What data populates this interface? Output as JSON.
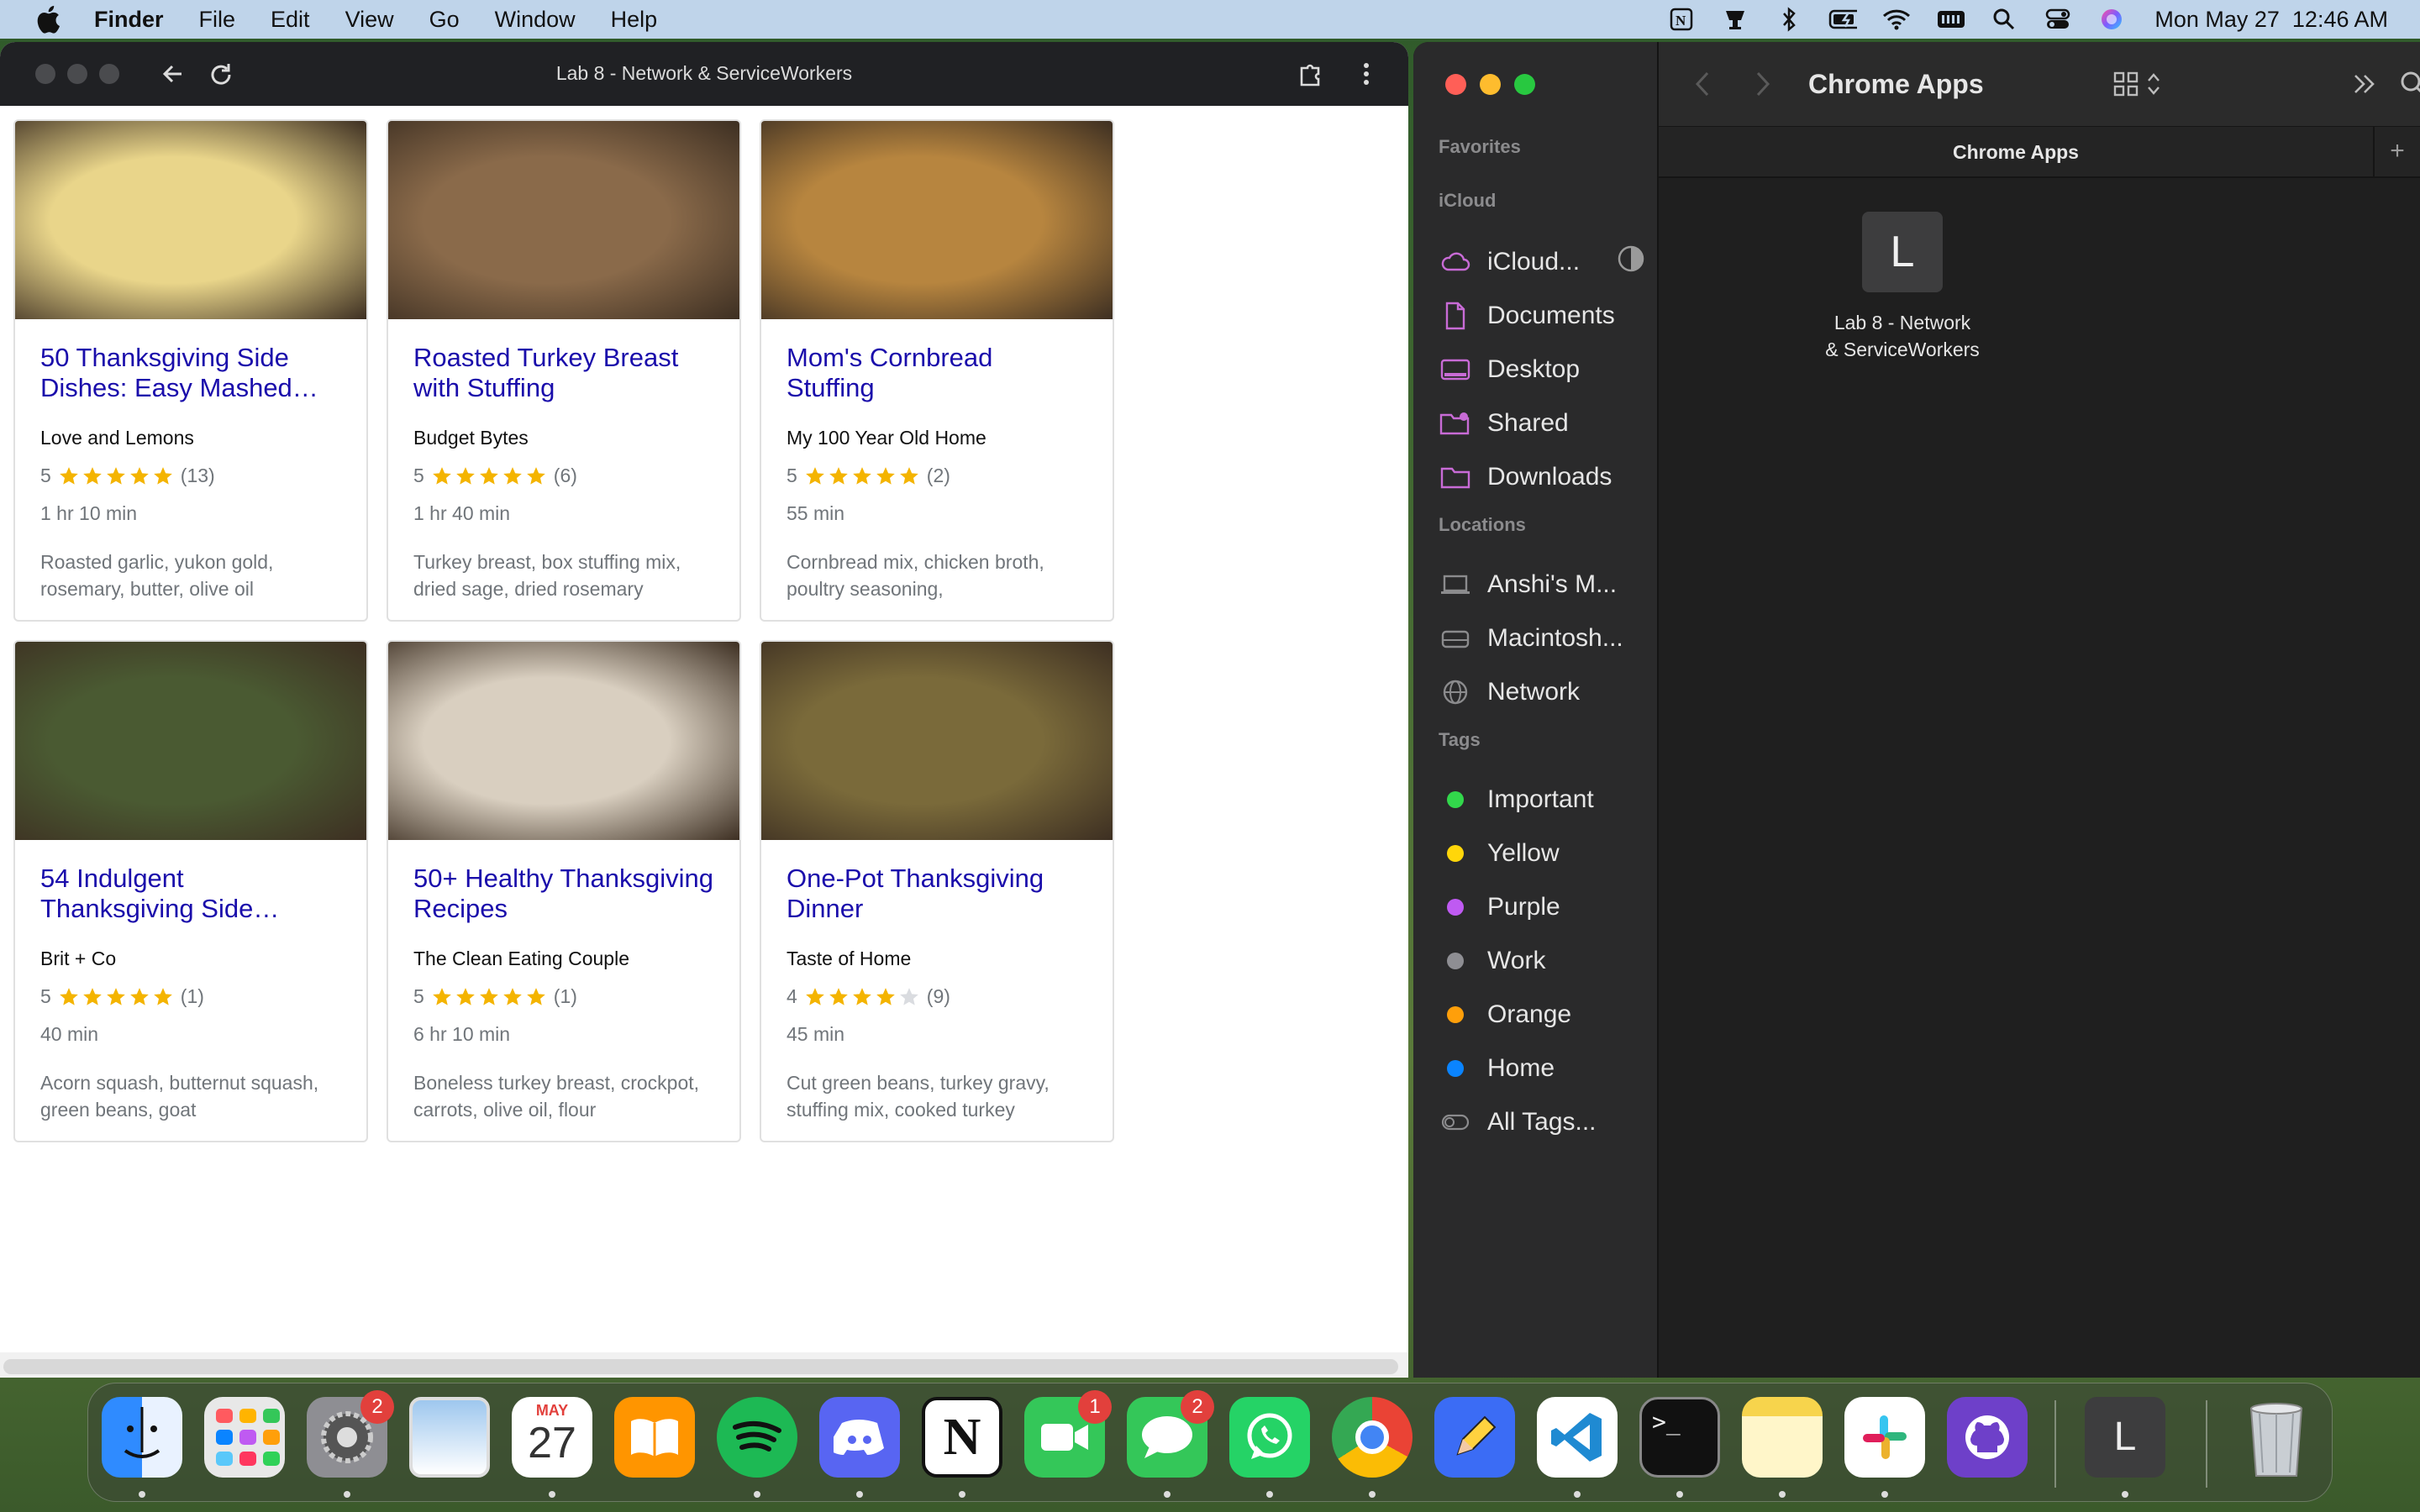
{
  "menubar": {
    "app_name": "Finder",
    "items": [
      "File",
      "Edit",
      "View",
      "Go",
      "Window",
      "Help"
    ],
    "clock": "Mon May 27  12:46 AM",
    "status_icons": [
      "notion-icon",
      "cup-icon",
      "bluetooth-icon",
      "battery-icon",
      "wifi-icon",
      "keyboard-icon",
      "spotlight-icon",
      "control-center-icon",
      "siri-icon"
    ]
  },
  "chrome": {
    "title": "Lab 8 - Network & ServiceWorkers",
    "cards": [
      {
        "title": "50 Thanksgiving Side Dishes: Easy Mashed…",
        "source": "Love and Lemons",
        "rating": "5",
        "stars": 5,
        "reviews": "(13)",
        "time": "1 hr 10 min",
        "ingredients": "Roasted garlic, yukon gold, rosemary, butter, olive oil",
        "image_color": "#e9d58a"
      },
      {
        "title": "Roasted Turkey Breast with Stuffing",
        "source": "Budget Bytes",
        "rating": "5",
        "stars": 5,
        "reviews": "(6)",
        "time": "1 hr 40 min",
        "ingredients": "Turkey breast, box stuffing mix, dried sage, dried rosemary",
        "image_color": "#8a6a4a"
      },
      {
        "title": "Mom's Cornbread Stuffing",
        "source": "My 100 Year Old Home",
        "rating": "5",
        "stars": 5,
        "reviews": "(2)",
        "time": "55 min",
        "ingredients": "Cornbread mix, chicken broth, poultry seasoning,",
        "image_color": "#b7853f"
      },
      {
        "title": "54 Indulgent Thanksgiving Side…",
        "source": "Brit + Co",
        "rating": "5",
        "stars": 5,
        "reviews": "(1)",
        "time": "40 min",
        "ingredients": "Acorn squash, butternut squash, green beans, goat",
        "image_color": "#4a5a32"
      },
      {
        "title": "50+ Healthy Thanksgiving Recipes",
        "source": "The Clean Eating Couple",
        "rating": "5",
        "stars": 5,
        "reviews": "(1)",
        "time": "6 hr 10 min",
        "ingredients": "Boneless turkey breast, crockpot, carrots, olive oil, flour",
        "image_color": "#d9cfc0"
      },
      {
        "title": "One-Pot Thanksgiving Dinner",
        "source": "Taste of Home",
        "rating": "4",
        "stars": 4,
        "reviews": "(9)",
        "time": "45 min",
        "ingredients": "Cut green beans, turkey gravy, stuffing mix, cooked turkey",
        "image_color": "#7a6a3a"
      }
    ]
  },
  "finder": {
    "sidebar": {
      "favorites_label": "Favorites",
      "icloud_label": "iCloud",
      "icloud_items": [
        "iCloud...",
        "Documents",
        "Desktop",
        "Shared",
        "Downloads"
      ],
      "locations_label": "Locations",
      "location_items": [
        "Anshi's M...",
        "Macintosh...",
        "Network"
      ],
      "tags_label": "Tags",
      "tags": [
        {
          "label": "Important",
          "color": "#32d74b"
        },
        {
          "label": "Yellow",
          "color": "#ffd60a"
        },
        {
          "label": "Purple",
          "color": "#bf5af2"
        },
        {
          "label": "Work",
          "color": "#8e8e93"
        },
        {
          "label": "Orange",
          "color": "#ff9f0a"
        },
        {
          "label": "Home",
          "color": "#0a84ff"
        }
      ],
      "all_tags": "All Tags..."
    },
    "toolbar_title": "Chrome Apps",
    "tab_label": "Chrome Apps",
    "file": {
      "icon_letter": "L",
      "label_line1": "Lab 8 - Network",
      "label_line2": "& ServiceWorkers"
    }
  },
  "dock": {
    "apps": [
      "Finder",
      "Launchpad",
      "System Settings",
      "Preview",
      "Calendar",
      "Books",
      "Spotify",
      "Discord",
      "Notion",
      "FaceTime",
      "Messages",
      "WhatsApp",
      "Chrome",
      "Pencil",
      "VS Code",
      "Terminal",
      "Notes",
      "Slack",
      "GitHub Desktop",
      "Lab 8",
      "Trash"
    ],
    "badges": {
      "System Settings": "2",
      "FaceTime": "1",
      "Messages": "2"
    },
    "calendar_month": "MAY",
    "calendar_day": "27",
    "lab_letter": "L"
  }
}
